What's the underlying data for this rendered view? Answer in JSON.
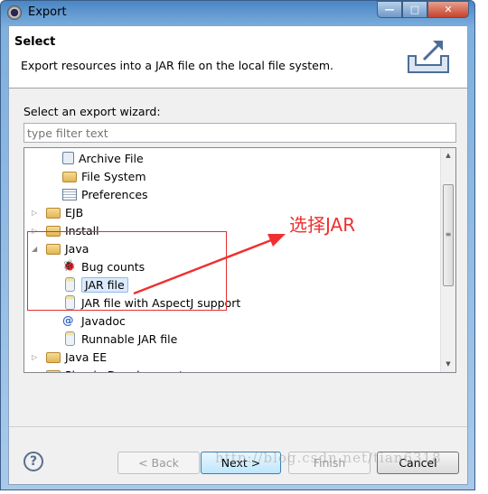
{
  "window": {
    "title": "Export",
    "icon": "eclipse-gear-icon"
  },
  "header": {
    "title": "Select",
    "description": "Export resources into a JAR file on the local file system.",
    "icon": "export-wizard-icon"
  },
  "wizard_label": "Select an export wizard:",
  "filter": {
    "value": "",
    "placeholder": "type filter text"
  },
  "tree": [
    {
      "label": "Archive File",
      "level": 1,
      "icon": "archive-icon"
    },
    {
      "label": "File System",
      "level": 1,
      "icon": "folder-icon"
    },
    {
      "label": "Preferences",
      "level": 1,
      "icon": "preferences-icon"
    },
    {
      "label": "EJB",
      "level": 0,
      "icon": "folder-icon",
      "expanded": false
    },
    {
      "label": "Install",
      "level": 0,
      "icon": "folder-icon",
      "expanded": false
    },
    {
      "label": "Java",
      "level": 0,
      "icon": "folder-icon",
      "expanded": true
    },
    {
      "label": "Bug counts",
      "level": 1,
      "icon": "bug-icon"
    },
    {
      "label": "JAR file",
      "level": 1,
      "icon": "jar-icon",
      "selected": true
    },
    {
      "label": "JAR file with AspectJ support",
      "level": 1,
      "icon": "jar-icon"
    },
    {
      "label": "Javadoc",
      "level": 1,
      "icon": "javadoc-icon"
    },
    {
      "label": "Runnable JAR file",
      "level": 1,
      "icon": "runnable-jar-icon"
    },
    {
      "label": "Java EE",
      "level": 0,
      "icon": "folder-icon",
      "expanded": false
    },
    {
      "label": "Plug-in Development",
      "level": 0,
      "icon": "folder-icon",
      "expanded": false
    }
  ],
  "buttons": {
    "back": "< Back",
    "next": "Next >",
    "finish": "Finish",
    "cancel": "Cancel",
    "help": "?"
  },
  "annotation": {
    "text": "选择JAR",
    "color": "#f03030"
  },
  "watermark": "http://blog.csdn.net/tian6318"
}
